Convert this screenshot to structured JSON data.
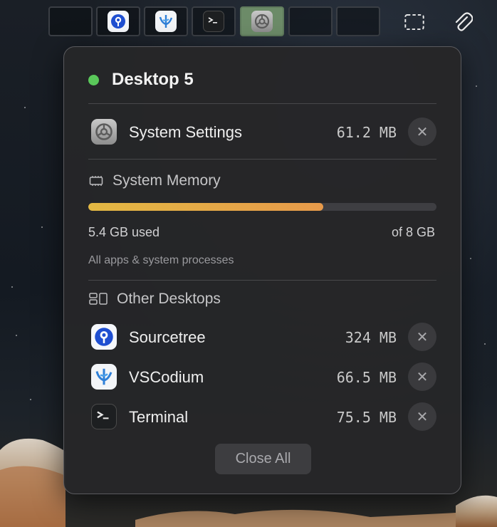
{
  "topbar": {
    "workspaces": [
      {
        "label": "",
        "app": null,
        "active": false
      },
      {
        "label": "",
        "app": "sourcetree-icon",
        "active": false
      },
      {
        "label": "",
        "app": "vscodium-icon",
        "active": false
      },
      {
        "label": "",
        "app": "terminal-icon",
        "active": false
      },
      {
        "label": "",
        "app": "system-settings-icon",
        "active": true
      },
      {
        "label": "",
        "app": null,
        "active": false
      },
      {
        "label": "",
        "app": null,
        "active": false
      }
    ],
    "tools": [
      "screenshot-selection-icon",
      "paperclip-icon"
    ]
  },
  "popover": {
    "title": "Desktop 5",
    "status_color": "#5ac85a",
    "current_apps": [
      {
        "name": "System Settings",
        "memory": "61.2 MB",
        "icon": "system-settings-icon",
        "close": "✕"
      }
    ],
    "memory": {
      "heading": "System Memory",
      "used_label": "5.4 GB used",
      "total_label": "of 8 GB",
      "fraction": 0.675,
      "note": "All apps & system processes"
    },
    "other": {
      "heading": "Other Desktops",
      "apps": [
        {
          "name": "Sourcetree",
          "memory": "324 MB",
          "icon": "sourcetree-icon",
          "close": "✕"
        },
        {
          "name": "VSCodium",
          "memory": "66.5 MB",
          "icon": "vscodium-icon",
          "close": "✕"
        },
        {
          "name": "Terminal",
          "memory": "75.5 MB",
          "icon": "terminal-icon",
          "close": "✕"
        }
      ]
    },
    "close_all": "Close All"
  }
}
